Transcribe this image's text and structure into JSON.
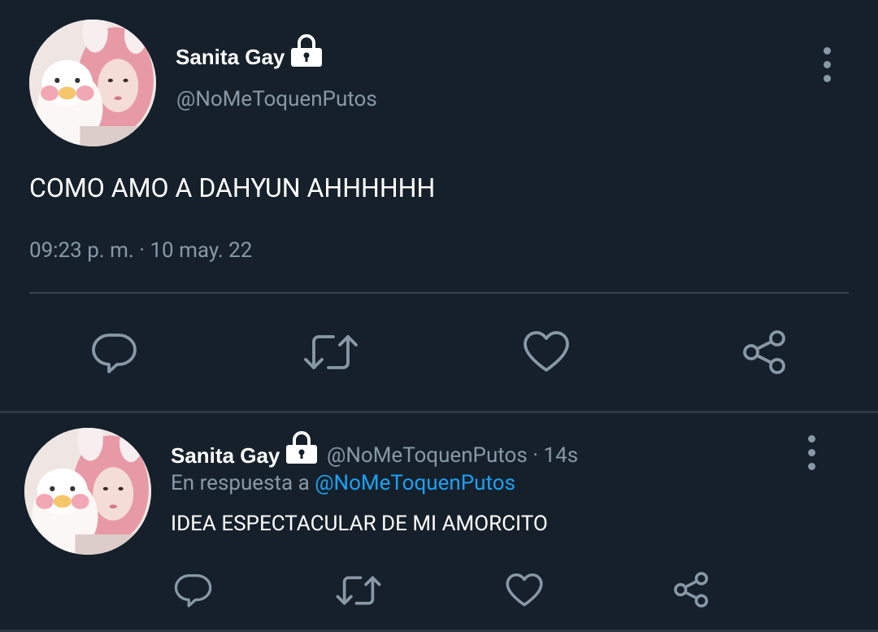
{
  "main_tweet": {
    "display_name": "Sanita Gay",
    "handle": "@NoMeToquenPutos",
    "text": "COMO AMO A DAHYUN AHHHHHH",
    "timestamp": "09:23 p. m. · 10 may. 22",
    "actions": [
      "reply-icon",
      "retweet-icon",
      "like-icon",
      "share-icon"
    ]
  },
  "reply_tweet": {
    "display_name": "Sanita Gay",
    "handle_time": "@NoMeToquenPutos · 14s",
    "reply_prefix": "En respuesta a",
    "reply_to": "@NoMeToquenPutos",
    "text": "IDEA ESPECTACULAR DE MI AMORCITO",
    "actions": [
      "reply-icon",
      "retweet-icon",
      "like-icon",
      "share-icon"
    ]
  },
  "colors": {
    "background": "#15202b",
    "secondary_text": "#8899a6",
    "link": "#1da1f2",
    "divider": "#38444d"
  }
}
